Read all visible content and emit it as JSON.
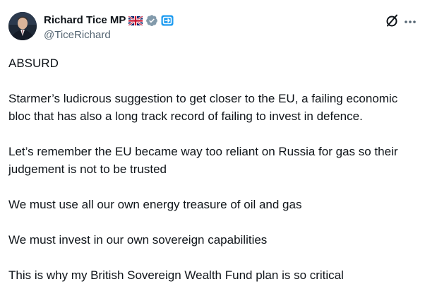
{
  "author": {
    "name": "Richard Tice MP",
    "handle": "@TiceRichard",
    "badges": [
      "uk-flag-icon",
      "verified-badge-icon",
      "automated-label-icon"
    ]
  },
  "actions": {
    "grok_icon": "grok-slash-circle-icon",
    "more_icon": "more-horizontal-icon"
  },
  "tweet": {
    "paragraphs": [
      "ABSURD",
      "Starmer’s ludicrous suggestion to get closer to the EU, a failing economic bloc that has also a long track record of failing to invest in defence.",
      "Let’s remember the EU became way too reliant on Russia for gas so their judgement is not to be trusted",
      "We must use all our own energy treasure of oil and gas",
      "We must invest in our own sovereign capabilities",
      "This is why my British Sovereign Wealth Fund plan is so critical"
    ]
  },
  "colors": {
    "text": "#0f1419",
    "secondary": "#536471",
    "verified": "#829aab",
    "accent": "#1d9bf0"
  }
}
